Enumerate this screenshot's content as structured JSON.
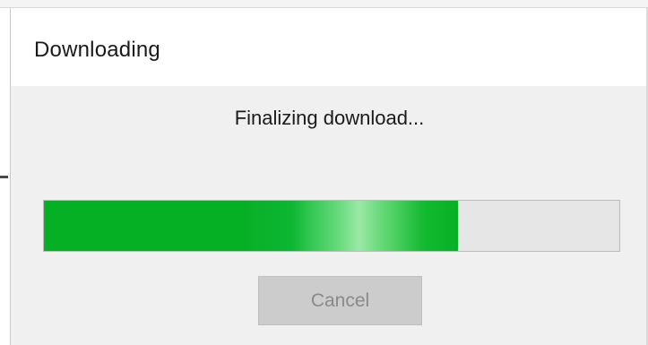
{
  "window": {
    "title": "Downloading"
  },
  "status": {
    "message": "Finalizing download..."
  },
  "progress": {
    "value_fraction": 0.72,
    "fill_color": "#06b025",
    "highlight_color": "#9be9a6",
    "track_color": "#e6e6e6"
  },
  "actions": {
    "cancel_label": "Cancel",
    "cancel_enabled": false
  },
  "colors": {
    "dialog_background": "#f0f0f0",
    "titlebar_background": "#ffffff",
    "button_disabled_background": "#cccccc",
    "button_disabled_text": "#8a8a8a"
  }
}
